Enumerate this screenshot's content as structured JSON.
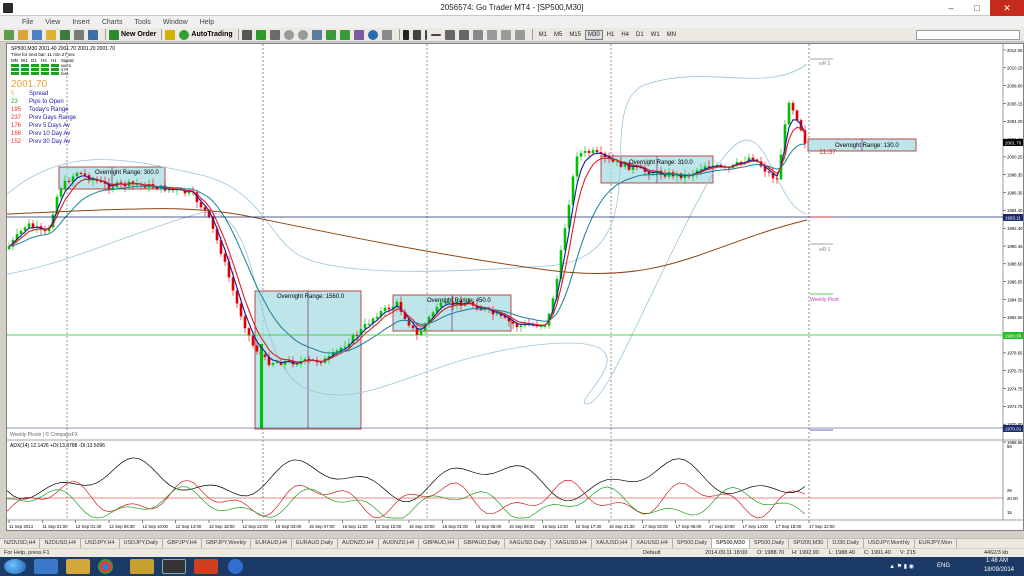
{
  "window": {
    "title": "2056574: Go Trader MT4 - [SP500,M30]",
    "minimize": "–",
    "maximize": "□",
    "close": "✕"
  },
  "menu": [
    "File",
    "View",
    "Insert",
    "Charts",
    "Tools",
    "Window",
    "Help"
  ],
  "toolbar": {
    "new_order": "New Order",
    "autotrading": "AutoTrading",
    "timeframes": [
      "M1",
      "M5",
      "M15",
      "M30",
      "H1",
      "H4",
      "D1",
      "W1",
      "MN"
    ],
    "active_timeframe": "M30"
  },
  "chart": {
    "header": "SP500,M30  2001.40 2001.70 2001.20 2001.70",
    "timer": "Time for next bar: 11 min 27 sec",
    "mtf_labels": [
      "MN",
      "W1",
      "D1",
      "H4",
      "H1",
      "Signal"
    ],
    "mtf_indicators": [
      "MACD",
      "STR",
      "EMA"
    ],
    "big_price": "2001.70",
    "stats": [
      {
        "value": "5",
        "label": "Spread"
      },
      {
        "value": "23",
        "label": "Pips to Open"
      },
      {
        "value": "195",
        "label": "Today's Range"
      },
      {
        "value": "237",
        "label": "Prev Days Range"
      },
      {
        "value": "176",
        "label": "Prev 5 Days Av"
      },
      {
        "value": "166",
        "label": "Prev 10 Day Av"
      },
      {
        "value": "152",
        "label": "Prev 30 Day Av"
      }
    ],
    "overnight_ranges": [
      "Overnight Range: 300.0",
      "Overnight Range: 1560.0",
      "Overnight Range: 450.0",
      "Overnight Range: 310.0",
      "Overnight Range: 130.0"
    ],
    "timer_badge": "11:37",
    "pivot_labels": [
      "wR 2",
      "wR 1",
      "Weekly Pivot"
    ],
    "price_axis": [
      "2012.05",
      "2010.15",
      "2008.00",
      "2006.15",
      "2004.20",
      "2002.25",
      "2000.25",
      "1998.35",
      "1996.35",
      "1994.40",
      "1992.40",
      "1990.45",
      "1988.50",
      "1986.55",
      "1984.55",
      "1982.60",
      "1980.60",
      "1978.65",
      "1976.70",
      "1974.75",
      "1972.75",
      "1970.80",
      "1968.85"
    ],
    "current_price_tag": "2001.70",
    "level_tags": [
      "1993.11",
      "1980.95",
      "1970.01"
    ],
    "footer_label": "Weekly Pivots | © CompassFX",
    "adx_label": "ADX(14) 12.1426 +DI:13.3788 -DI:13.5096",
    "adx_axis": [
      "56",
      "29",
      "20.00",
      "15"
    ],
    "time_axis": [
      "11 Sep 2014",
      "11 Sep 21:00",
      "12 Sep 01:30",
      "12 Sep 05:30",
      "12 Sep 10:00",
      "12 Sep 14:00",
      "12 Sep 18:00",
      "12 Sep 22:00",
      "15 Sep 03:00",
      "15 Sep 07:00",
      "15 Sep 11:00",
      "15 Sep 15:00",
      "15 Sep 19:00",
      "16 Sep 01:00",
      "16 Sep 05:00",
      "16 Sep 09:30",
      "16 Sep 13:30",
      "16 Sep 17:30",
      "16 Sep 21:30",
      "17 Sep 02:00",
      "17 Sep 06:00",
      "17 Sep 10:00",
      "17 Sep 14:00",
      "17 Sep 18:00",
      "17 Sep 22:00"
    ]
  },
  "tabs": [
    "NZDUSD,H4",
    "NZDUSD,H4",
    "USDJPY,H4",
    "USDJPY,Daily",
    "GBPJPY,H4",
    "GBPJPY,Weekly",
    "EURAUD,H4",
    "EURAUD,Daily",
    "AUDNZD,H4",
    "AUDNZD,H4",
    "GBPAUD,H4",
    "GBPAUD,Daily",
    "XAGUSD,Daily",
    "XAGUSD,H4",
    "XAUUSD,H4",
    "XAUUSD,H4",
    "SP500,Daily",
    "SP500,M30",
    "SP500,Daily",
    "SPI200,M30",
    "DJ30,Daily",
    "USDJPY,Monthly",
    "EURJPY,Mon"
  ],
  "active_tab": "SP500,M30",
  "status": {
    "help": "For Help, press F1",
    "profile": "Default",
    "datetime": "2014.09.11 18:00",
    "open": "O: 1988.70",
    "high": "H: 1992.90",
    "low": "L: 1988.40",
    "close": "C: 1991.40",
    "volume": "V: 215",
    "traffic": "4462/3 kb"
  },
  "taskbar": {
    "lang": "ENG",
    "time": "1:48 AM",
    "date": "18/09/2014"
  },
  "colors": {
    "chart_bg": "#ffffff",
    "candle_up": "#00c000",
    "candle_down": "#e00000",
    "ema_fast": "#1a1aa0",
    "ema_mid": "#e02020",
    "ema_slow": "#1a7f9a",
    "sma_long": "#8b4513",
    "bollinger": "#9bc4dc",
    "range_fill": "#a8dce2",
    "range_border": "#6b2c8c"
  }
}
